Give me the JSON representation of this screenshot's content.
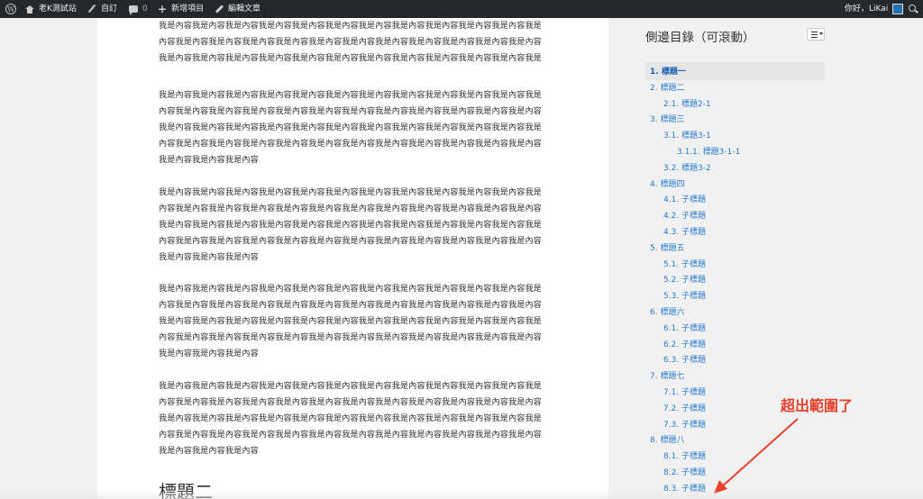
{
  "adminbar": {
    "site_name": "老K測試站",
    "customize": "自訂",
    "comments_count": "0",
    "new_item": "新增項目",
    "edit_post": "編輯文章",
    "greeting": "你好，LiKai"
  },
  "article": {
    "para_line_full": "我是內容我是內容我是內容我是內容我是內容我是內容我是內容我是內容我是內容我是內容我是內容我是內容我是內容我是內容我是內容我是內容我是內容我是內容我是內容我是內容我是內容我是內容我是內容我是內容我是內容我是內容我是內容我是內容我是內容我是內容我是內容我是內容我是內容我是內容我是內容我是內容我是內容我是內容我是內容我是內容我是內容我是內容我是內容我是內容我是內容我是內容我是內容我是內容我是內容我是內容我是內容",
    "top_partial": "內容我是內容我是內容我是內容我是內容我是內容我是內容我是內容我是內容我是內容我是內容我是內容我是內容我是內容我是內容我是內容我是內容我是內容我是內容我是內容我是內容我是內容我是內容我是內容我是內容我是內容我是內容我是內容我是內容我是內容我是內容我是內容我是內容我是內容我是內容我是內容我是內容我是內容我是內容我是內容我是內容我是內容我是內容我是內容我是內容我是內容我是內容我是內容我是內容",
    "para_1": "我是內容我是內容我是內容我是內容我是內容我是內容我是內容我是內容我是內容我是內容我是內容我是內容我是內容我是內容我是內容我是內容我是內容我是內容我是內容我是內容我是內容我是內容我是內容我是內容我是內容我是內容我是內容我是內容我是內容我是內容我是內容我是內容我是內容我是內容我是內容我是內容我是內容我是內容我是內容我是內容我是內容我是內容我是內容我是內容我是內容我是內容我是內容我是內容我是內容",
    "para_2": "我是內容我是內容我是內容我是內容我是內容我是內容我是內容我是內容我是內容我是內容我是內容我是內容我是內容我是內容我是內容我是內容我是內容我是內容我是內容我是內容我是內容我是內容我是內容我是內容我是內容我是內容我是內容我是內容我是內容我是內容我是內容我是內容我是內容我是內容我是內容我是內容我是內容我是內容我是內容我是內容我是內容我是內容我是內容我是內容我是內容我是內容我是內容我是內容我是內容",
    "para_3": "我是內容我是內容我是內容我是內容我是內容我是內容我是內容我是內容我是內容我是內容我是內容我是內容我是內容我是內容我是內容我是內容我是內容我是內容我是內容我是內容我是內容我是內容我是內容我是內容我是內容我是內容我是內容我是內容我是內容我是內容我是內容我是內容我是內容我是內容我是內容我是內容我是內容我是內容我是內容我是內容我是內容我是內容我是內容我是內容我是內容我是內容我是內容我是內容我是內容",
    "para_4": "我是內容我是內容我是內容我是內容我是內容我是內容我是內容我是內容我是內容我是內容我是內容我是內容我是內容我是內容我是內容我是內容我是內容我是內容我是內容我是內容我是內容我是內容我是內容我是內容我是內容我是內容我是內容我是內容我是內容我是內容我是內容我是內容我是內容我是內容我是內容我是內容我是內容我是內容我是內容我是內容我是內容我是內容我是內容我是內容我是內容我是內容我是內容我是內容我是內容",
    "heading_2": "標題二"
  },
  "sidebar": {
    "title": "側邊目錄（可滾動）",
    "toc": [
      {
        "label": "1. 標題一",
        "active": true
      },
      {
        "label": "2. 標題二"
      },
      {
        "label": "2.1. 標題2-1"
      },
      {
        "label": "3. 標題三"
      },
      {
        "label": "3.1. 標題3-1"
      },
      {
        "label": "3.1.1. 標題3-1-1"
      },
      {
        "label": "3.2. 標題3-2"
      },
      {
        "label": "4. 標題四"
      },
      {
        "label": "4.1. 子標題"
      },
      {
        "label": "4.2. 子標題"
      },
      {
        "label": "4.3. 子標題"
      },
      {
        "label": "5. 標題五"
      },
      {
        "label": "5.1. 子標題"
      },
      {
        "label": "5.2. 子標題"
      },
      {
        "label": "5.3. 子標題"
      },
      {
        "label": "6. 標題六"
      },
      {
        "label": "6.1. 子標題"
      },
      {
        "label": "6.2. 子標題"
      },
      {
        "label": "6.3. 子標題"
      },
      {
        "label": "7. 標題七"
      },
      {
        "label": "7.1. 子標題"
      },
      {
        "label": "7.2. 子標題"
      },
      {
        "label": "7.3. 子標題"
      },
      {
        "label": "8. 標題八"
      },
      {
        "label": "8.1. 子標題"
      },
      {
        "label": "8.2. 子標題"
      },
      {
        "label": "8.3. 子標題"
      }
    ]
  },
  "annotation": {
    "text": "超出範圍了",
    "color": "#e8412b"
  }
}
